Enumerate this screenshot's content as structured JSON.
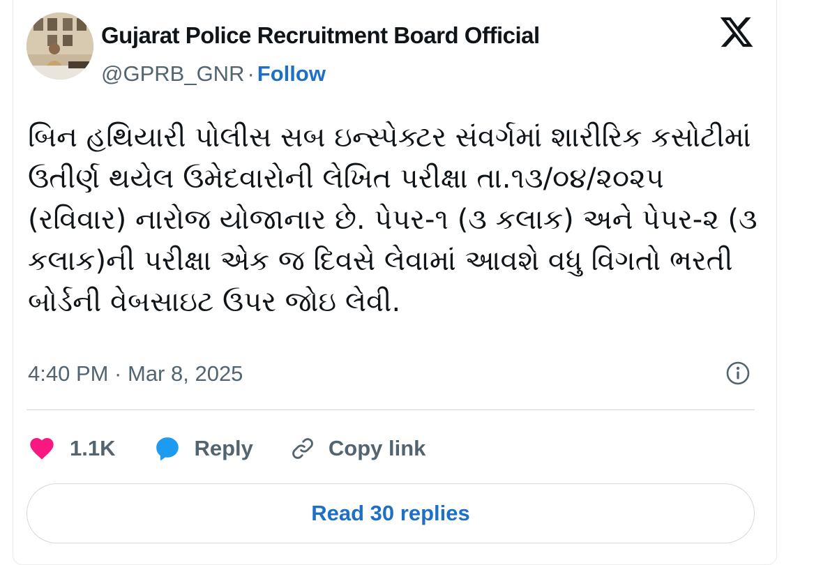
{
  "tweet": {
    "author_name": "Gujarat Police Recruitment Board Official",
    "handle": "@GPRB_GNR",
    "separator": "·",
    "follow_label": "Follow",
    "text": "બિન હથિયારી પોલીસ સબ ઇન્સ્પેક્ટર સંવર્ગમાં શારીરિક કસોટીમાં\nઉતીર્ણ થયેલ ઉમેદવારોની લેખિત પરીક્ષા તા.૧૩/૦૪/૨૦૨૫\n(રવિવાર) નારોજ યોજાનાર છે. પેપર-૧ (૩ કલાક) અને પેપર-૨ (૩\nકલાક)ની પરીક્ષા એક જ દિવસે લેવામાં આવશે વધુ વિગતો ભરતી\nબોર્ડની વેબસાઇટ ઉપર જોઇ લેવી.",
    "timestamp": "4:40 PM · Mar 8, 2025"
  },
  "actions": {
    "like_count": "1.1K",
    "reply_label": "Reply",
    "copy_link_label": "Copy link"
  },
  "read_replies_label": "Read 30 replies",
  "icons": {
    "logo": "x-logo-icon",
    "info": "info-icon",
    "like": "heart-icon",
    "reply": "speech-bubble-icon",
    "copy_link": "link-icon"
  },
  "colors": {
    "accent_blue": "#1d6fc7",
    "like_pink": "#f91880",
    "reply_blue": "#1d9bf0",
    "muted_text": "#536471",
    "main_text": "#0f1419"
  }
}
